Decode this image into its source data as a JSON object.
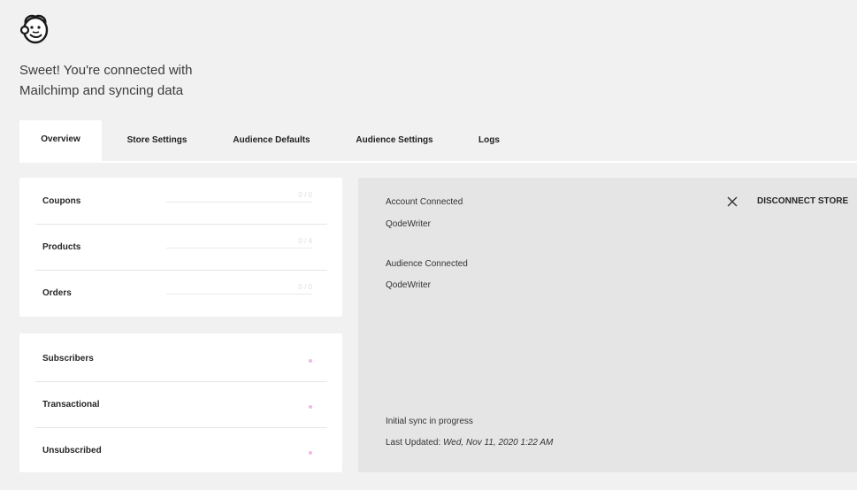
{
  "header": {
    "logo_icon": "mailchimp-freddie-icon",
    "headline": "Sweet! You're connected with Mailchimp and syncing data"
  },
  "tabs": [
    {
      "label": "Overview",
      "active": true
    },
    {
      "label": "Store Settings",
      "active": false
    },
    {
      "label": "Audience Defaults",
      "active": false
    },
    {
      "label": "Audience Settings",
      "active": false
    },
    {
      "label": "Logs",
      "active": false
    }
  ],
  "sync_stats": {
    "coupons": {
      "label": "Coupons",
      "count": "0 / 0",
      "progress": 0
    },
    "products": {
      "label": "Products",
      "count": "0 / 4",
      "progress": 0
    },
    "orders": {
      "label": "Orders",
      "count": "0 / 0",
      "progress": 0
    }
  },
  "audience_stats": {
    "subscribers": {
      "label": "Subscribers"
    },
    "transactional": {
      "label": "Transactional"
    },
    "unsubscribed": {
      "label": "Unsubscribed"
    },
    "dot_color": "#f2b6ec"
  },
  "connection": {
    "account_label": "Account Connected",
    "account_value": "QodeWriter",
    "audience_label": "Audience Connected",
    "audience_value": "QodeWriter",
    "sync_status": "Initial sync in progress",
    "last_updated_label": "Last Updated:",
    "last_updated_value": "Wed, Nov 11, 2020 1:22 AM",
    "disconnect_label": "DISCONNECT STORE",
    "disconnect_icon": "close-icon"
  },
  "colors": {
    "page_bg": "#f1f1f1",
    "panel_bg": "#e5e5e5",
    "card_bg": "#ffffff"
  }
}
